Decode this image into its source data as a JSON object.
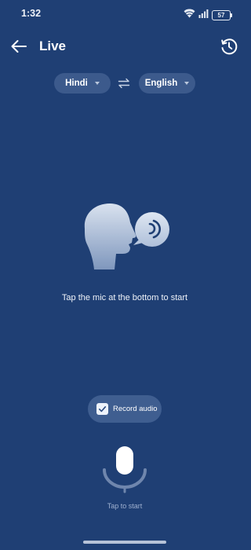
{
  "status_bar": {
    "time": "1:32",
    "battery_level": "57",
    "icons": [
      "wifi-icon",
      "signal-icon",
      "battery-icon"
    ]
  },
  "header": {
    "title": "Live",
    "back_icon": "arrow-left-icon",
    "history_icon": "history-icon"
  },
  "languages": {
    "source": "Hindi",
    "target": "English",
    "swap_icon": "swap-arrows-icon"
  },
  "main": {
    "illustration": "speaking-head-icon",
    "hint": "Tap the mic at the bottom to start"
  },
  "record": {
    "label": "Record audio",
    "checked": true
  },
  "mic": {
    "label": "Tap to start",
    "icon": "mic-icon"
  },
  "colors": {
    "background": "#1f3f74",
    "chip": "#3c5a8c",
    "accent_text": "#ffffff",
    "muted_text": "#9eb0cf"
  }
}
